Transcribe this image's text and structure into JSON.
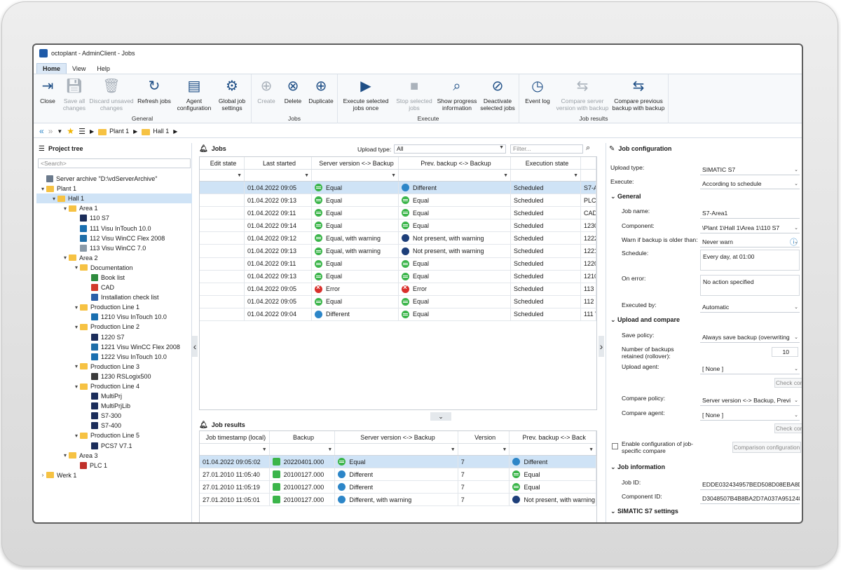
{
  "window": {
    "title": "octoplant - AdminClient - Jobs"
  },
  "menu": [
    "Home",
    "View",
    "Help"
  ],
  "ribbon": {
    "groups": [
      {
        "label": "General",
        "buttons": [
          {
            "label": "Close",
            "icon": "close-door-icon",
            "enabled": true
          },
          {
            "label": "Save all changes",
            "icon": "save-icon",
            "enabled": false
          },
          {
            "label": "Discard unsaved changes",
            "icon": "trash-icon",
            "enabled": false
          },
          {
            "label": "Refresh jobs",
            "icon": "refresh-bell-icon",
            "enabled": true
          },
          {
            "label": "Agent configuration",
            "icon": "agent-server-icon",
            "enabled": true
          },
          {
            "label": "Global job settings",
            "icon": "gear-icon",
            "enabled": true
          }
        ]
      },
      {
        "label": "Jobs",
        "buttons": [
          {
            "label": "Create",
            "icon": "create-bell-icon",
            "enabled": false
          },
          {
            "label": "Delete",
            "icon": "delete-bell-icon",
            "enabled": true
          },
          {
            "label": "Duplicate",
            "icon": "duplicate-bell-icon",
            "enabled": true
          }
        ]
      },
      {
        "label": "Execute",
        "buttons": [
          {
            "label": "Execute selected jobs once",
            "icon": "play-bell-icon",
            "enabled": true
          },
          {
            "label": "Stop selected jobs",
            "icon": "stop-bell-icon",
            "enabled": false
          },
          {
            "label": "Show progress information",
            "icon": "progress-icon",
            "enabled": true
          },
          {
            "label": "Deactivate selected jobs",
            "icon": "deactivate-bell-icon",
            "enabled": true
          }
        ]
      },
      {
        "label": "Job results",
        "buttons": [
          {
            "label": "Event log",
            "icon": "event-log-icon",
            "enabled": true
          },
          {
            "label": "Compare server version with backup",
            "icon": "compare-server-icon",
            "enabled": false
          },
          {
            "label": "Compare previous backup with backup",
            "icon": "compare-backup-icon",
            "enabled": true
          }
        ]
      }
    ]
  },
  "breadcrumb": [
    "Plant 1",
    "Hall 1"
  ],
  "project_tree": {
    "title": "Project tree",
    "search_placeholder": "<Search>",
    "nodes": [
      {
        "label": "Server archive \"D:\\vdServerArchive\"",
        "level": 0,
        "twist": "",
        "icon": "server"
      },
      {
        "label": "Plant 1",
        "level": 0,
        "twist": "▾",
        "icon": "folder"
      },
      {
        "label": "Hall 1",
        "level": 1,
        "twist": "▾",
        "icon": "folder",
        "selected": true
      },
      {
        "label": "Area 1",
        "level": 2,
        "twist": "▾",
        "icon": "folder"
      },
      {
        "label": "110 S7",
        "level": 3,
        "twist": "",
        "icon": "s7"
      },
      {
        "label": "111 Visu InTouch 10.0",
        "level": 3,
        "twist": "",
        "icon": "intouch"
      },
      {
        "label": "112 Visu WinCC Flex 2008",
        "level": 3,
        "twist": "",
        "icon": "wincc"
      },
      {
        "label": "113 Visu WinCC 7.0",
        "level": 3,
        "twist": "",
        "icon": "wincc7"
      },
      {
        "label": "Area 2",
        "level": 2,
        "twist": "▾",
        "icon": "folder"
      },
      {
        "label": "Documentation",
        "level": 3,
        "twist": "▾",
        "icon": "folder"
      },
      {
        "label": "Book list",
        "level": 4,
        "twist": "",
        "icon": "excel"
      },
      {
        "label": "CAD",
        "level": 4,
        "twist": "",
        "icon": "pdf"
      },
      {
        "label": "Installation check list",
        "level": 4,
        "twist": "",
        "icon": "doc"
      },
      {
        "label": "Production Line 1",
        "level": 3,
        "twist": "▾",
        "icon": "folder"
      },
      {
        "label": "1210 Visu InTouch 10.0",
        "level": 4,
        "twist": "",
        "icon": "intouch"
      },
      {
        "label": "Production Line 2",
        "level": 3,
        "twist": "▾",
        "icon": "folder"
      },
      {
        "label": "1220 S7",
        "level": 4,
        "twist": "",
        "icon": "s7"
      },
      {
        "label": "1221 Visu WinCC Flex 2008",
        "level": 4,
        "twist": "",
        "icon": "wincc"
      },
      {
        "label": "1222 Visu InTouch 10.0",
        "level": 4,
        "twist": "",
        "icon": "intouch"
      },
      {
        "label": "Production Line 3",
        "level": 3,
        "twist": "▾",
        "icon": "folder"
      },
      {
        "label": "1230 RSLogix500",
        "level": 4,
        "twist": "",
        "icon": "rslogix"
      },
      {
        "label": "Production Line 4",
        "level": 3,
        "twist": "▾",
        "icon": "folder"
      },
      {
        "label": "MultiPrj",
        "level": 4,
        "twist": "",
        "icon": "s7"
      },
      {
        "label": "MultiPrjLib",
        "level": 4,
        "twist": "",
        "icon": "s7"
      },
      {
        "label": "S7-300",
        "level": 4,
        "twist": "",
        "icon": "s7"
      },
      {
        "label": "S7-400",
        "level": 4,
        "twist": "",
        "icon": "s7"
      },
      {
        "label": "Production Line 5",
        "level": 3,
        "twist": "▾",
        "icon": "folder"
      },
      {
        "label": "PCS7 V7.1",
        "level": 4,
        "twist": "",
        "icon": "s7"
      },
      {
        "label": "Area 3",
        "level": 2,
        "twist": "▾",
        "icon": "folder"
      },
      {
        "label": "PLC 1",
        "level": 3,
        "twist": "",
        "icon": "plc"
      },
      {
        "label": "Werk 1",
        "level": 0,
        "twist": "›",
        "icon": "folder"
      }
    ]
  },
  "jobs": {
    "title": "Jobs",
    "upload_type_label": "Upload type:",
    "upload_type_value": "All",
    "filter_placeholder": "Filter...",
    "columns": [
      "Edit state",
      "Last started",
      "Server version <-> Backup",
      "Prev. backup <-> Backup",
      "Execution state",
      ""
    ],
    "rows": [
      {
        "last_started": "01.04.2022 09:05",
        "server": "Equal",
        "server_status": "eq",
        "prev": "Different",
        "prev_status": "diff",
        "state": "Scheduled",
        "extra": "S7-A",
        "selected": true
      },
      {
        "last_started": "01.04.2022 09:13",
        "server": "Equal",
        "server_status": "eq",
        "prev": "Equal",
        "prev_status": "eq",
        "state": "Scheduled",
        "extra": "PLC"
      },
      {
        "last_started": "01.04.2022 09:11",
        "server": "Equal",
        "server_status": "eq",
        "prev": "Equal",
        "prev_status": "eq",
        "state": "Scheduled",
        "extra": "CAD"
      },
      {
        "last_started": "01.04.2022 09:14",
        "server": "Equal",
        "server_status": "eq",
        "prev": "Equal",
        "prev_status": "eq",
        "state": "Scheduled",
        "extra": "1230"
      },
      {
        "last_started": "01.04.2022 09:12",
        "server": "Equal, with warning",
        "server_status": "warn",
        "prev": "Not present, with warning",
        "prev_status": "np",
        "state": "Scheduled",
        "extra": "1222"
      },
      {
        "last_started": "01.04.2022 09:13",
        "server": "Equal, with warning",
        "server_status": "warn",
        "prev": "Not present, with warning",
        "prev_status": "np",
        "state": "Scheduled",
        "extra": "1221"
      },
      {
        "last_started": "01.04.2022 09:11",
        "server": "Equal",
        "server_status": "eq",
        "prev": "Equal",
        "prev_status": "eq",
        "state": "Scheduled",
        "extra": "1220"
      },
      {
        "last_started": "01.04.2022 09:13",
        "server": "Equal",
        "server_status": "eq",
        "prev": "Equal",
        "prev_status": "eq",
        "state": "Scheduled",
        "extra": "1210"
      },
      {
        "last_started": "01.04.2022 09:05",
        "server": "Error",
        "server_status": "err",
        "prev": "Error",
        "prev_status": "err",
        "state": "Scheduled",
        "extra": "113 V"
      },
      {
        "last_started": "01.04.2022 09:05",
        "server": "Equal",
        "server_status": "eq",
        "prev": "Equal",
        "prev_status": "eq",
        "state": "Scheduled",
        "extra": "112 V"
      },
      {
        "last_started": "01.04.2022 09:04",
        "server": "Different",
        "server_status": "diff",
        "prev": "Equal",
        "prev_status": "eq",
        "state": "Scheduled",
        "extra": "111 V"
      }
    ]
  },
  "job_results": {
    "title": "Job results",
    "columns": [
      "Job timestamp (local)",
      "Backup",
      "Server version <-> Backup",
      "Version",
      "Prev. backup <-> Back"
    ],
    "rows": [
      {
        "timestamp": "01.04.2022 09:05:02",
        "backup": "20220401.000",
        "server": "Equal",
        "server_status": "eq",
        "version": "7",
        "prev": "Different",
        "prev_status": "diff",
        "selected": true
      },
      {
        "timestamp": "27.01.2010 11:05:40",
        "backup": "20100127.000",
        "server": "Different",
        "server_status": "diff",
        "version": "7",
        "prev": "Equal",
        "prev_status": "eq"
      },
      {
        "timestamp": "27.01.2010 11:05:19",
        "backup": "20100127.000",
        "server": "Different",
        "server_status": "diff",
        "version": "7",
        "prev": "Equal",
        "prev_status": "eq"
      },
      {
        "timestamp": "27.01.2010 11:05:01",
        "backup": "20100127.000",
        "server": "Different, with warning",
        "server_status": "diffwarn",
        "version": "7",
        "prev": "Not present, with warning",
        "prev_status": "np"
      }
    ]
  },
  "job_config": {
    "title": "Job configuration",
    "upload_type_label": "Upload type:",
    "upload_type": "SIMATIC S7",
    "execute_label": "Execute:",
    "execute": "According to schedule",
    "general_section": "General",
    "job_name_label": "Job name:",
    "job_name": "S7-Area1",
    "component_label": "Component:",
    "component": "\\Plant 1\\Hall 1\\Area 1\\110 S7",
    "warn_label": "Warn if backup is older than:",
    "warn": "Never warn",
    "schedule_label": "Schedule:",
    "schedule": "Every day, at 01:00",
    "on_error_label": "On error:",
    "on_error": "No action specified",
    "executed_by_label": "Executed by:",
    "executed_by": "Automatic",
    "upload_compare_section": "Upload and compare",
    "save_policy_label": "Save policy:",
    "save_policy": "Always save backup (overwriting",
    "num_backups_label": "Number of backups retained (rollover):",
    "num_backups": "10",
    "upload_agent_label": "Upload agent:",
    "upload_agent": "[ None ]",
    "check_connection": "Check connection",
    "compare_policy_label": "Compare policy:",
    "compare_policy": "Server version <-> Backup, Previ",
    "compare_agent_label": "Compare agent:",
    "compare_agent": "[ None ]",
    "enable_config_label": "Enable configuration of job-specific compare",
    "comparison_configuration": "Comparison configuration",
    "job_info_section": "Job information",
    "job_id_label": "Job ID:",
    "job_id": "EDDE032434957BED508D08EBA8DBD",
    "component_id_label": "Component ID:",
    "component_id": "D3048507B4B8BA2D7A037A9512481",
    "simatic_section": "SIMATIC S7 settings"
  }
}
